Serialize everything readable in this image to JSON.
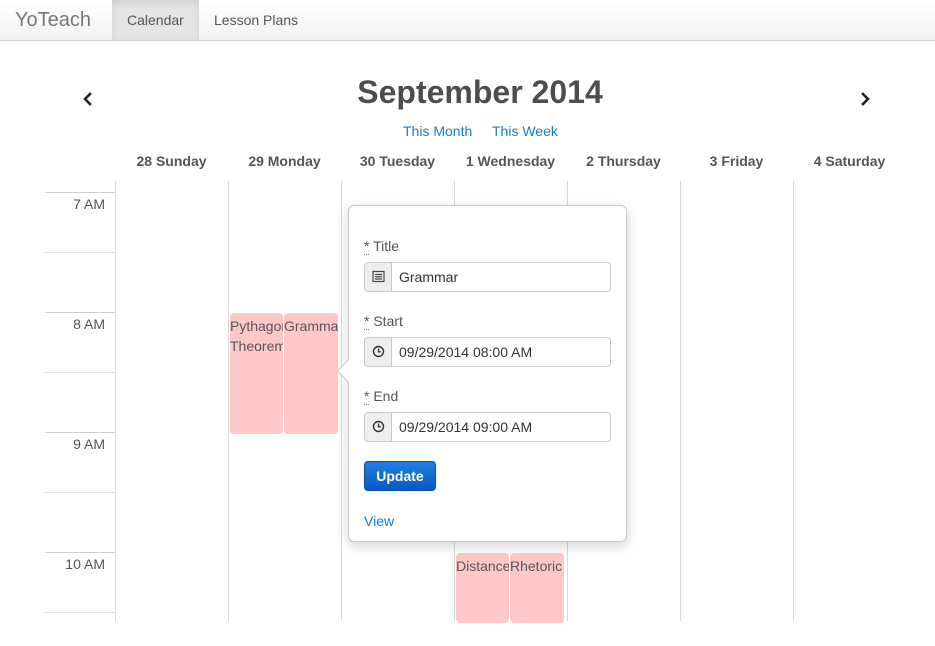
{
  "navbar": {
    "brand": "YoTeach",
    "items": [
      {
        "label": "Calendar",
        "active": true
      },
      {
        "label": "Lesson Plans",
        "active": false
      }
    ]
  },
  "calendar": {
    "month_title": "September 2014",
    "range_links": [
      "This Month",
      "This Week"
    ],
    "days": [
      "28 Sunday",
      "29 Monday",
      "30 Tuesday",
      "1 Wednesday",
      "2 Thursday",
      "3 Friday",
      "4 Saturday"
    ],
    "hours": [
      "7 AM",
      "8 AM",
      "9 AM",
      "10 AM"
    ],
    "events": [
      {
        "title": "Pythagorean Theorem",
        "day": "29 Monday"
      },
      {
        "title": "Grammar",
        "day": "29 Monday"
      },
      {
        "title": "Distance",
        "day": "1 Wednesday"
      },
      {
        "title": "Rhetoric",
        "day": "1 Wednesday"
      }
    ]
  },
  "popover": {
    "title_label": "Title",
    "title_value": "Grammar",
    "start_label": "Start",
    "start_value": "09/29/2014 08:00 AM",
    "end_label": "End",
    "end_value": "09/29/2014 09:00 AM",
    "required_marker": "*",
    "update_label": "Update",
    "view_label": "View"
  },
  "colors": {
    "event_bg": "#ffc8c8",
    "link": "#1a7bc9",
    "primary_button": "#0b58c2"
  },
  "icons": [
    "chevron-left-icon",
    "chevron-right-icon",
    "list-icon",
    "clock-icon"
  ]
}
